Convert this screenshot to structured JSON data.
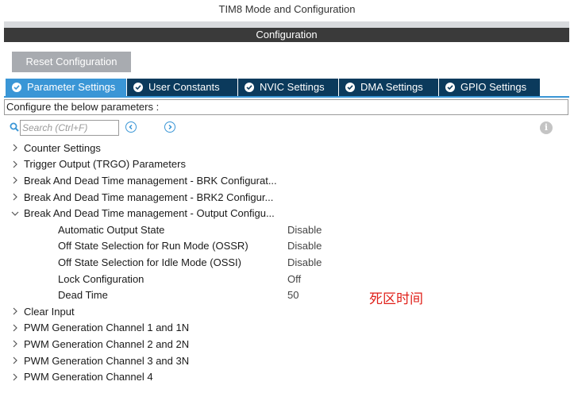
{
  "window": {
    "title": "TIM8 Mode and Configuration"
  },
  "section": {
    "title": "Configuration"
  },
  "toolbar": {
    "reset_label": "Reset Configuration"
  },
  "tabs": [
    {
      "label": "Parameter Settings",
      "active": true
    },
    {
      "label": "User Constants",
      "active": false
    },
    {
      "label": "NVIC Settings",
      "active": false
    },
    {
      "label": "DMA Settings",
      "active": false
    },
    {
      "label": "GPIO Settings",
      "active": false
    }
  ],
  "configure_text": "Configure the below parameters :",
  "search": {
    "placeholder": "Search (Ctrl+F)",
    "value": ""
  },
  "tree": {
    "groups_before": [
      {
        "label": "Counter Settings",
        "expanded": false
      },
      {
        "label": "Trigger Output (TRGO) Parameters",
        "expanded": false
      },
      {
        "label": "Break And Dead Time management - BRK Configurat...",
        "expanded": false
      },
      {
        "label": "Break And Dead Time management - BRK2 Configur...",
        "expanded": false
      }
    ],
    "expanded_group": {
      "label": "Break And Dead Time management - Output Configu...",
      "expanded": true,
      "params": [
        {
          "name": "Automatic Output State",
          "value": "Disable"
        },
        {
          "name": "Off State Selection for Run Mode (OSSR)",
          "value": "Disable"
        },
        {
          "name": "Off State Selection for Idle Mode (OSSI)",
          "value": "Disable"
        },
        {
          "name": "Lock Configuration",
          "value": "Off"
        },
        {
          "name": "Dead Time",
          "value": "50"
        }
      ]
    },
    "groups_after": [
      {
        "label": "Clear Input",
        "expanded": false
      },
      {
        "label": "PWM Generation Channel 1 and 1N",
        "expanded": false
      },
      {
        "label": "PWM Generation Channel 2 and 2N",
        "expanded": false
      },
      {
        "label": "PWM Generation Channel 3 and 3N",
        "expanded": false
      },
      {
        "label": "PWM Generation Channel 4",
        "expanded": false
      }
    ]
  },
  "annotation": {
    "text": "死区时间",
    "color": "#e0201a"
  },
  "colors": {
    "tab_active": "#3a96d6",
    "tab_inactive": "#0b3a5c",
    "section_bar": "#3a3a3a",
    "reset_button": "#a8abb0"
  },
  "icons": {
    "tab_check": "check-circle-icon",
    "search": "search-icon",
    "prev": "chevron-left-circle-icon",
    "next": "chevron-right-circle-icon",
    "info": "info-icon",
    "collapsed": "chevron-right-icon",
    "expanded": "chevron-down-icon"
  }
}
